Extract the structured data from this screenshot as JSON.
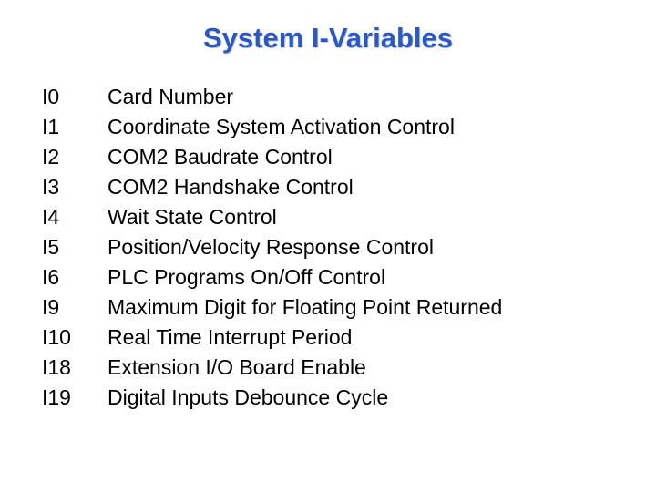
{
  "slide": {
    "title": "System I-Variables",
    "title_color": "#2b58c4",
    "background_color": "#ffffff",
    "text_color": "#000000"
  },
  "variables": [
    {
      "name": "I0",
      "description": "Card Number"
    },
    {
      "name": "I1",
      "description": "Coordinate System Activation Control"
    },
    {
      "name": "I2",
      "description": "COM2 Baudrate Control"
    },
    {
      "name": "I3",
      "description": "COM2 Handshake Control"
    },
    {
      "name": "I4",
      "description": "Wait State Control"
    },
    {
      "name": "I5",
      "description": "Position/Velocity Response Control"
    },
    {
      "name": "I6",
      "description": "PLC Programs On/Off Control"
    },
    {
      "name": "I9",
      "description": "Maximum Digit for Floating Point Returned"
    },
    {
      "name": "I10",
      "description": "Real Time Interrupt Period"
    },
    {
      "name": "I18",
      "description": "Extension I/O Board Enable"
    },
    {
      "name": "I19",
      "description": "Digital Inputs Debounce Cycle"
    }
  ]
}
